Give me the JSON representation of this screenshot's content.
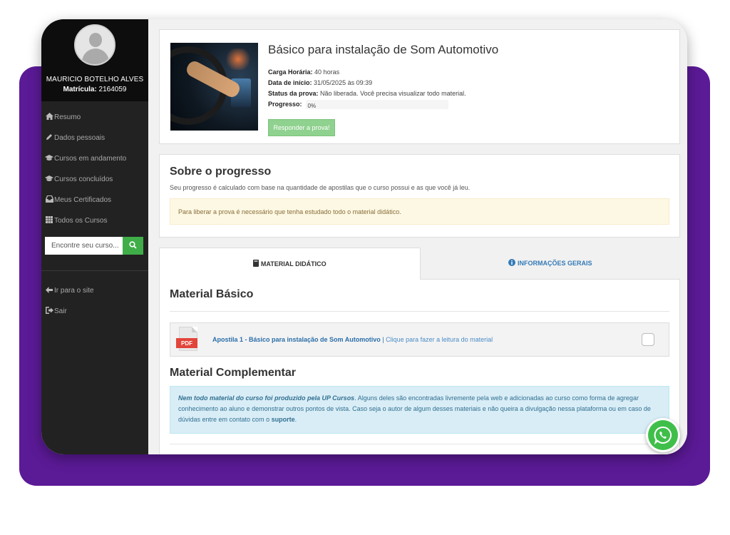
{
  "profile": {
    "name": "MAURICIO BOTELHO ALVES",
    "matricula_label": "Matrícula:",
    "matricula_value": "2164059"
  },
  "sidebar": {
    "items": [
      {
        "label": "Resumo",
        "icon": "home-icon"
      },
      {
        "label": "Dados pessoais",
        "icon": "pencil-icon"
      },
      {
        "label": "Cursos em andamento",
        "icon": "graduation-cap-icon"
      },
      {
        "label": "Cursos concluídos",
        "icon": "graduation-cap-icon"
      },
      {
        "label": "Meus Certificados",
        "icon": "inbox-icon"
      },
      {
        "label": "Todos os Cursos",
        "icon": "grid-icon"
      }
    ],
    "search_placeholder": "Encontre seu curso...",
    "secondary_items": [
      {
        "label": "Ir para o site",
        "icon": "arrow-left-icon"
      },
      {
        "label": "Sair",
        "icon": "sign-out-icon"
      }
    ]
  },
  "course": {
    "title": "Básico para instalação de Som Automotivo",
    "carga_label": "Carga Horária:",
    "carga_value": "40 horas",
    "inicio_label": "Data de início:",
    "inicio_value": "31/05/2025 às 09:39",
    "status_label": "Status da prova:",
    "status_value": "Não liberada. Você precisa visualizar todo material.",
    "progress_label": "Progresso:",
    "progress_value": 0,
    "progress_text": "0%",
    "button_label": "Responder a prova!"
  },
  "about": {
    "title": "Sobre o progresso",
    "text": "Seu progresso é calculado com base na quantidade de apostilas que o curso possui e as que você já leu.",
    "warning": "Para liberar a prova é necessário que tenha estudado todo o material didático."
  },
  "tabs": [
    {
      "label": "MATERIAL DIDÁTICO",
      "icon": "book-icon",
      "active": true
    },
    {
      "label": "INFORMAÇÕES GERAIS",
      "icon": "info-circle-icon",
      "active": false
    }
  ],
  "material": {
    "basic_title": "Material Básico",
    "pdf_tag": "PDF",
    "item_title": "Apostila 1 - Básico para instalação de Som Automotivo",
    "item_separator": " | ",
    "item_sub": "Clique para fazer a leitura do material",
    "complementary_title": "Material Complementar",
    "info_bold": "Nem todo material do curso foi produzido pela UP Cursos",
    "info_text": ". Alguns deles são encontradas livremente pela web e adicionadas ao curso como forma de agregar conhecimento ao aluno e demonstrar outros pontos de vista. Caso seja o autor de algum desses materiais e não queira a divulgação nessa plataforma ou em caso de dúvidas entre em contato com o ",
    "info_link": "suporte",
    "info_end": "."
  },
  "colors": {
    "brand_purple": "#5b1a96",
    "sidebar_dark": "#222222",
    "success_green": "#3fae49",
    "link_blue": "#337ab7"
  }
}
